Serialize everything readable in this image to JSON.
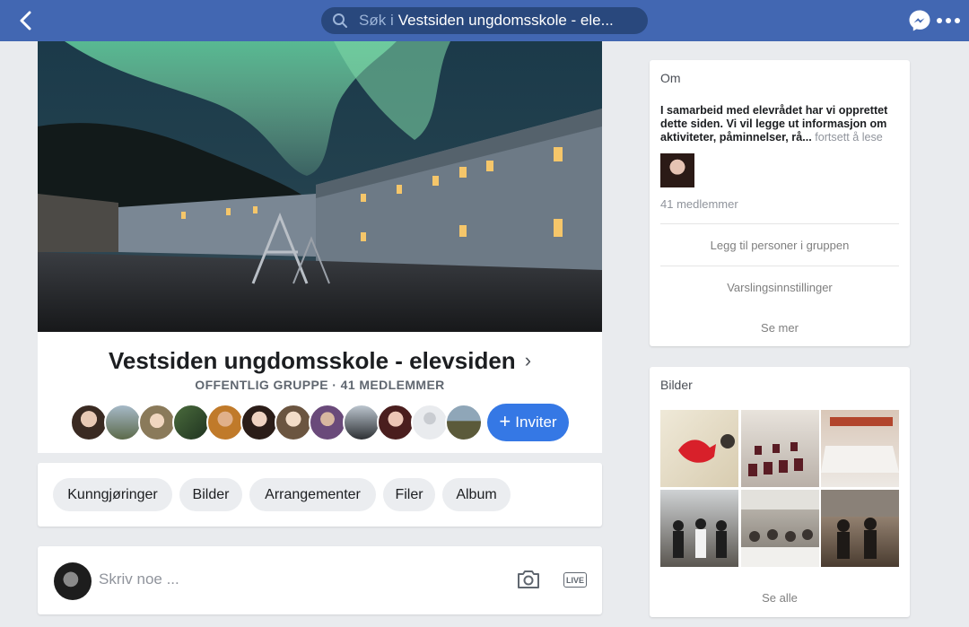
{
  "topbar": {
    "search_prefix": "Søk i",
    "search_query": "Vestsiden ungdomsskole - ele..."
  },
  "group": {
    "title": "Vestsiden ungdomsskole - elevsiden",
    "subtitle": "OFFENTLIG GRUPPE · 41 MEDLEMMER",
    "invite_label": "Inviter"
  },
  "tabs": [
    {
      "label": "Kunngjøringer"
    },
    {
      "label": "Bilder"
    },
    {
      "label": "Arrangementer"
    },
    {
      "label": "Filer"
    },
    {
      "label": "Album"
    }
  ],
  "composer": {
    "placeholder": "Skriv noe ...",
    "live_label": "LIVE"
  },
  "about": {
    "heading": "Om",
    "text": "I samarbeid med elevrådet har vi opprettet dette siden. Vi vil legge ut informasjon om aktiviteter, påminnelser, rå...",
    "more_link": " fortsett å lese",
    "member_count": "41 medlemmer",
    "add_people": "Legg til personer i gruppen",
    "notifications": "Varslingsinnstillinger",
    "see_more": "Se mer"
  },
  "photos": {
    "heading": "Bilder",
    "see_all": "Se alle"
  },
  "colors": {
    "brand": "#4267b2",
    "accent": "#3578e5",
    "background": "#e9ebee"
  }
}
